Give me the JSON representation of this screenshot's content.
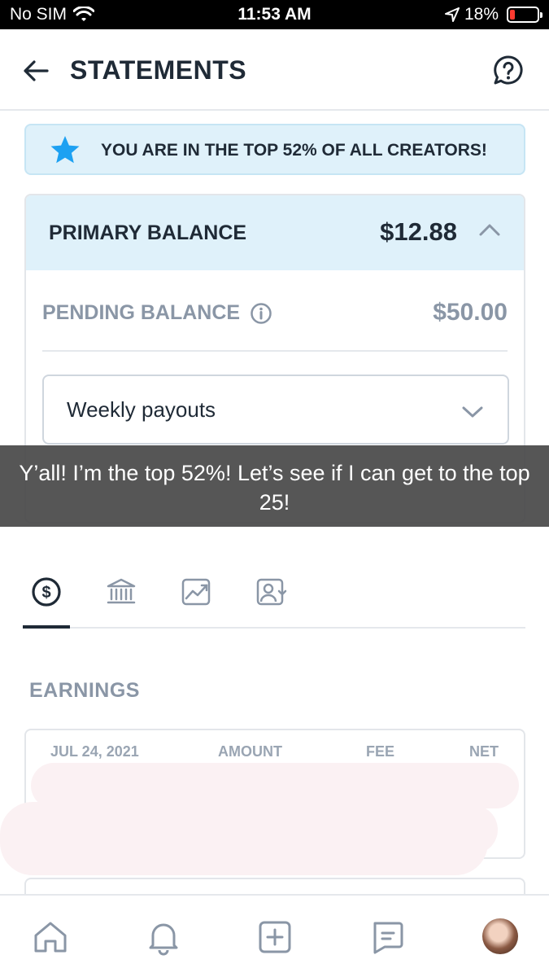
{
  "status_bar": {
    "carrier": "No SIM",
    "time": "11:53 AM",
    "battery": "18%",
    "battery_level": 0.18
  },
  "header": {
    "title": "STATEMENTS"
  },
  "banner": {
    "text": "YOU ARE IN THE TOP 52% OF ALL CREATORS!"
  },
  "balance": {
    "primary_label": "PRIMARY BALANCE",
    "primary_amount": "$12.88",
    "pending_label": "PENDING BALANCE",
    "pending_amount": "$50.00",
    "payout_select": "Weekly payouts"
  },
  "caption": "Y’all! I’m the top 52%! Let’s see if I can get to the top 25!",
  "tabs": [
    {
      "icon": "dollar-circle-icon",
      "active": true
    },
    {
      "icon": "bank-icon",
      "active": false
    },
    {
      "icon": "chart-icon",
      "active": false
    },
    {
      "icon": "user-card-icon",
      "active": false
    }
  ],
  "earnings": {
    "title": "EARNINGS",
    "columns": [
      "JUL 24, 2021",
      "AMOUNT",
      "FEE",
      "NET"
    ]
  },
  "bottom_nav": [
    "home-icon",
    "bell-icon",
    "add-post-icon",
    "messages-icon",
    "avatar"
  ],
  "colors": {
    "accent": "#1da1f2",
    "banner_bg": "#dff1fa",
    "text": "#1f2a36",
    "muted": "#8a96a6"
  }
}
